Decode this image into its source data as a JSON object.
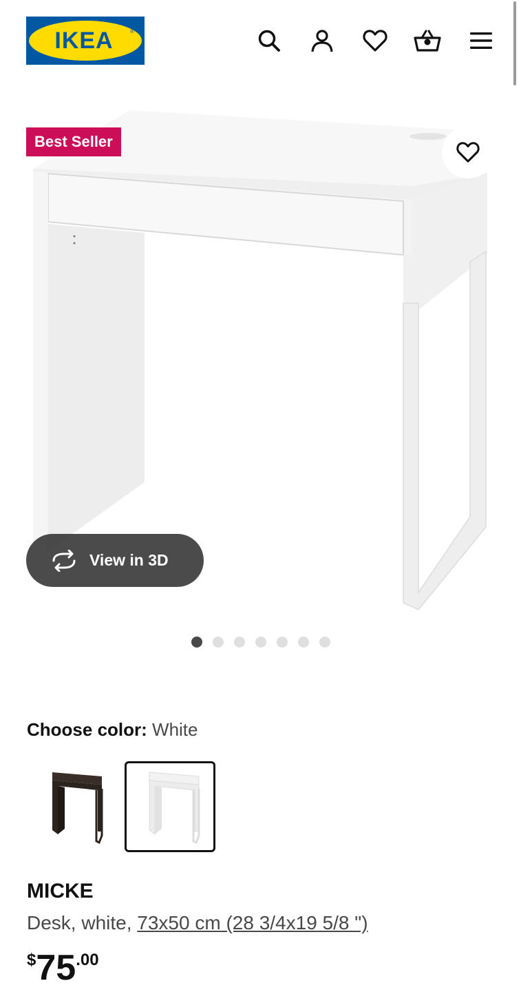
{
  "header": {
    "logo_text": "IKEA",
    "icons": [
      "search-icon",
      "account-icon",
      "heart-icon",
      "cart-icon",
      "menu-icon"
    ]
  },
  "gallery": {
    "badge": "Best Seller",
    "view_3d_label": "View in 3D",
    "dots_count": 7,
    "active_dot": 1
  },
  "color": {
    "label": "Choose color:",
    "value": "White",
    "options": [
      "black-brown",
      "white"
    ],
    "selected": "white"
  },
  "product": {
    "name": "MICKE",
    "desc_prefix": "Desk, white, ",
    "size": "73x50 cm (28 3/4x19 5/8 \")",
    "price_currency": "$",
    "price_int": "75",
    "price_dec": ".00"
  },
  "colors": {
    "ikea_blue": "#0058a3",
    "ikea_yellow": "#ffdb00",
    "badge": "#cc0d58"
  }
}
